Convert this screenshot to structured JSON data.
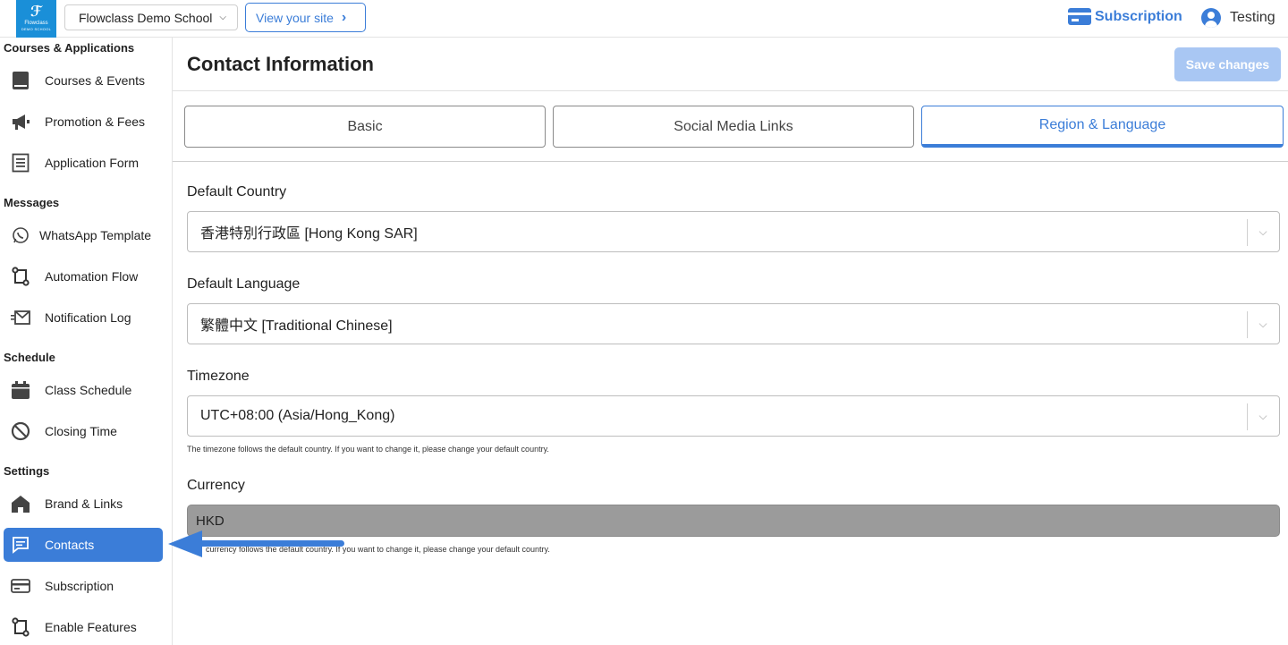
{
  "header": {
    "logo_name": "Flowclass",
    "logo_sub": "DEMO SCHOOL",
    "school_name": "Flowclass Demo School",
    "view_site_label": "View your site",
    "subscription_label": "Subscription",
    "user_name": "Testing"
  },
  "sidebar": {
    "sections": [
      {
        "title": "Courses & Applications",
        "items": [
          {
            "label": "Courses & Events",
            "icon": "book-icon"
          },
          {
            "label": "Promotion & Fees",
            "icon": "megaphone-icon"
          },
          {
            "label": "Application Form",
            "icon": "form-icon"
          }
        ]
      },
      {
        "title": "Messages",
        "items": [
          {
            "label": "WhatsApp Template",
            "icon": "whatsapp-icon"
          },
          {
            "label": "Automation Flow",
            "icon": "flow-icon"
          },
          {
            "label": "Notification Log",
            "icon": "log-icon"
          }
        ]
      },
      {
        "title": "Schedule",
        "items": [
          {
            "label": "Class Schedule",
            "icon": "calendar-icon"
          },
          {
            "label": "Closing Time",
            "icon": "prohibited-icon"
          }
        ]
      },
      {
        "title": "Settings",
        "items": [
          {
            "label": "Brand & Links",
            "icon": "home-icon"
          },
          {
            "label": "Contacts",
            "icon": "chat-icon",
            "active": true
          },
          {
            "label": "Subscription",
            "icon": "card-icon"
          },
          {
            "label": "Enable Features",
            "icon": "flow-icon"
          }
        ]
      }
    ]
  },
  "main": {
    "title": "Contact Information",
    "save_label": "Save changes",
    "tabs": [
      {
        "label": "Basic"
      },
      {
        "label": "Social Media Links"
      },
      {
        "label": "Region & Language",
        "active": true
      }
    ],
    "fields": {
      "country_label": "Default Country",
      "country_value": "香港特別行政區 [Hong Kong SAR]",
      "language_label": "Default Language",
      "language_value": "繁體中文 [Traditional Chinese]",
      "timezone_label": "Timezone",
      "timezone_value": "UTC+08:00 (Asia/Hong_Kong)",
      "timezone_hint": "The timezone follows the default country. If you want to change it, please change your default country.",
      "currency_label": "Currency",
      "currency_value": "HKD",
      "currency_hint": "currency follows the default country. If you want to change it, please change your default country."
    }
  },
  "colors": {
    "accent": "#3b7dd8",
    "logo_bg": "#1a8fd8",
    "save_disabled": "#a9c7f3",
    "currency_bg": "#9b9b9b"
  }
}
